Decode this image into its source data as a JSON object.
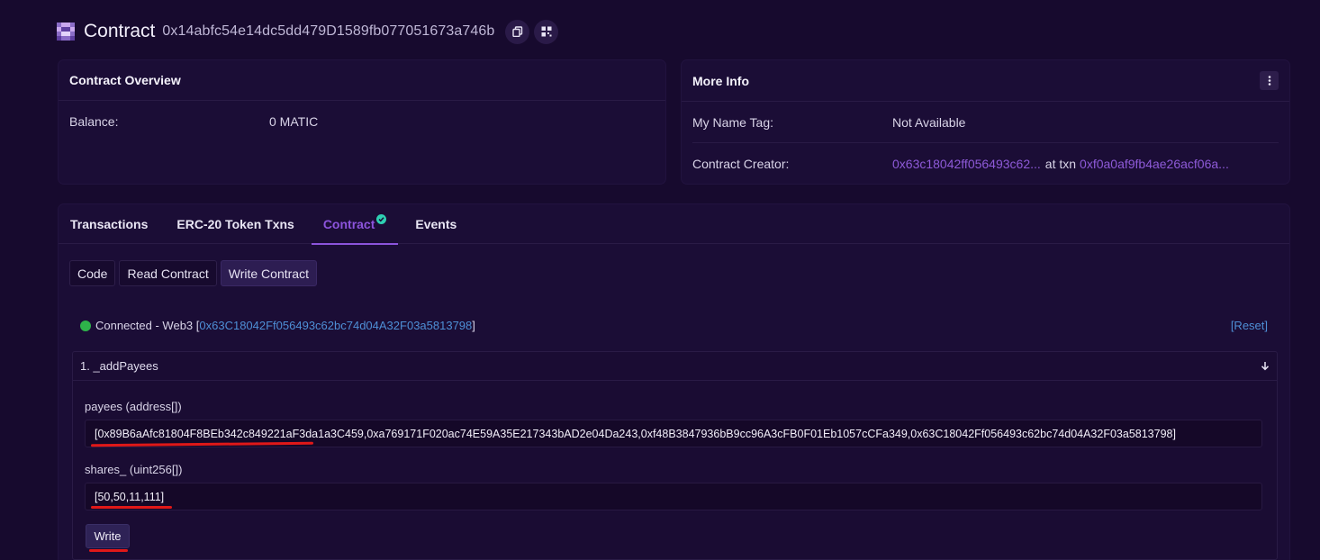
{
  "header": {
    "title": "Contract",
    "address": "0x14abfc54e14dc5dd479D1589fb077051673a746b",
    "copy_icon": "copy-icon",
    "qr_icon": "qr-code-icon"
  },
  "overview": {
    "title": "Contract Overview",
    "balance_label": "Balance:",
    "balance_value": "0 MATIC"
  },
  "more_info": {
    "title": "More Info",
    "name_tag_label": "My Name Tag:",
    "name_tag_value": "Not Available",
    "creator_label": "Contract Creator:",
    "creator_address": "0x63c18042ff056493c62...",
    "at_txn": "at txn",
    "creator_txn": "0xf0a0af9fb4ae26acf06a..."
  },
  "tabs": [
    {
      "label": "Transactions"
    },
    {
      "label": "ERC-20 Token Txns"
    },
    {
      "label": "Contract"
    },
    {
      "label": "Events"
    }
  ],
  "subtabs": [
    {
      "label": "Code"
    },
    {
      "label": "Read Contract"
    },
    {
      "label": "Write Contract"
    }
  ],
  "connection": {
    "status": "Connected - Web3 [",
    "address": "0x63C18042Ff056493c62bc74d04A32F03a5813798",
    "close": "]",
    "reset": "[Reset]"
  },
  "method": {
    "name": "1. _addPayees",
    "param1_label": "payees (address[])",
    "param1_value": "[0x89B6aAfc81804F8BEb342c849221aF3da1a3C459,0xa769171F020ac74E59A35E217343bAD2e04Da243,0xf48B3847936bB9cc96A3cFB0F01Eb1057cCFa349,0x63C18042Ff056493c62bc74d04A32F03a5813798]",
    "param2_label": "shares_ (uint256[])",
    "param2_value": "[50,50,11,111]",
    "write_label": "Write"
  },
  "colors": {
    "background": "#170a2e",
    "card": "#1b0d36",
    "accent": "#8c54dc",
    "link_blue": "#4e8fd6",
    "connected_green": "#2eb34a",
    "annotation_red": "#e01818"
  }
}
